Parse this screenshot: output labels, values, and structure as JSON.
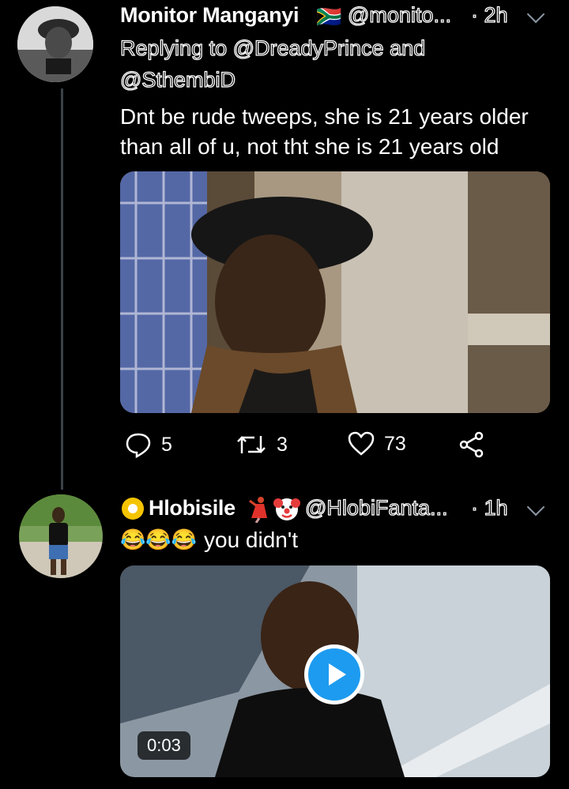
{
  "tweet1": {
    "display_name": "Monitor Manganyi",
    "flag_emoji": "🇿🇦",
    "handle": "@monito...",
    "time": "· 2h",
    "reply_prefix": "Replying to @DreadyPrince and",
    "reply_second": "@SthembiD",
    "text_line1": "Dnt be rude tweeps, she is 21 years older",
    "text_line2": "than all of u, not tht she is 21 years old",
    "replies": "5",
    "retweets": "3",
    "likes": "73"
  },
  "tweet2": {
    "display_name_prefix": "Hlobisile",
    "handle": "@HlobiFanta...",
    "time": "· 1h",
    "emoji_prefix": "😂😂😂",
    "text": "you didn't",
    "video_duration": "0:03"
  },
  "icons": [
    "reply-icon",
    "retweet-icon",
    "like-icon",
    "share-icon",
    "chevron-down-icon",
    "play-icon"
  ],
  "colors": {
    "background": "#000000",
    "muted": "#8b98a5",
    "play_button": "#1d9bf0"
  }
}
